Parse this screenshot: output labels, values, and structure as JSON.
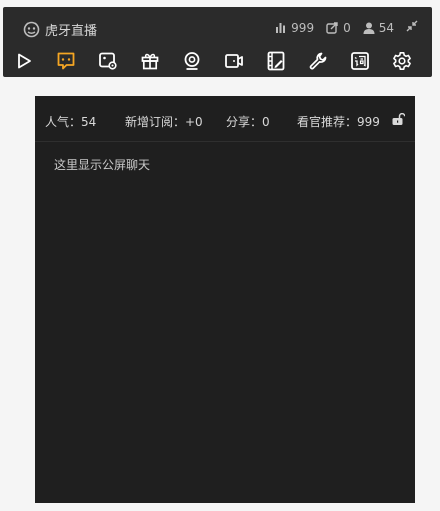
{
  "app": {
    "brand_name": "虎牙直播"
  },
  "stats": {
    "popularity": "999",
    "shares": "0",
    "viewers": "54"
  },
  "toolbar": {
    "icons": [
      "play-icon",
      "chat-bubble-icon",
      "screen-settings-icon",
      "gift-icon",
      "camera-icon",
      "video-icon",
      "film-edit-icon",
      "wrench-icon",
      "subtitle-icon",
      "gear-icon"
    ],
    "active_color": "#f5a623",
    "icon_color": "#ffffff"
  },
  "panel": {
    "popularity_label": "人气：54",
    "new_subs_label": "新增订阅：+0",
    "shares_label": "分享：0",
    "recommend_label": "看官推荐：999",
    "placeholder": "这里显示公屏聊天"
  }
}
